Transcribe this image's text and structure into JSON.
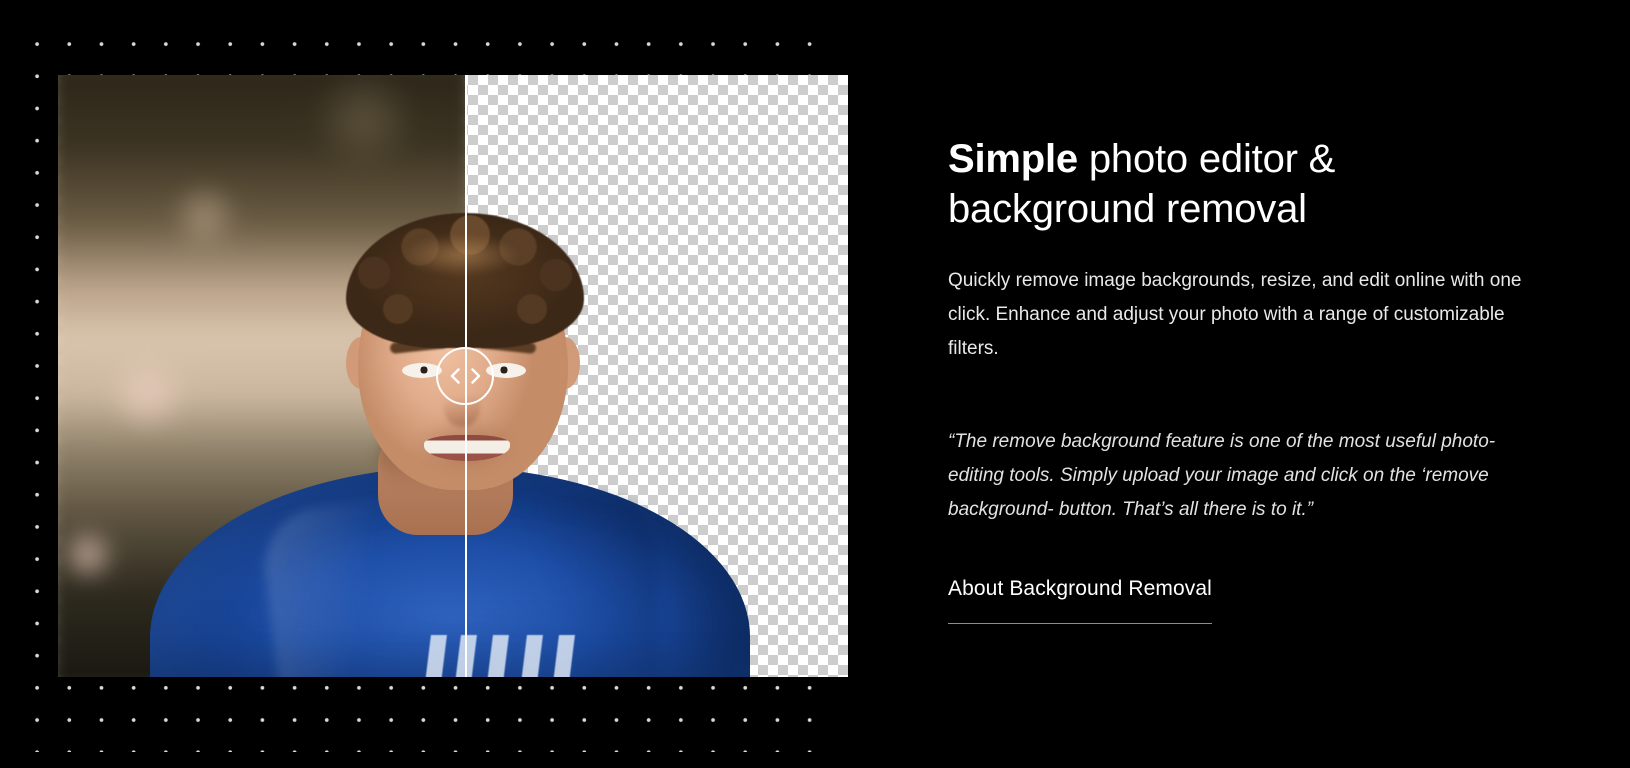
{
  "page": {
    "background_color": "#000000",
    "text_color": "#ffffff"
  },
  "decoration": {
    "dot_grid": {
      "dot_color": "#d9d9d9",
      "spacing_px": 32
    }
  },
  "media": {
    "widget_name": "before-after-comparison-slider",
    "before_label": "original photo with background",
    "after_label": "photo with background removed (transparent checkerboard)",
    "divider_position_percent": 51,
    "handle_icon_left": "chevron-left-icon",
    "handle_icon_right": "chevron-right-icon",
    "subject": "smiling young man with curly hair in a blue t-shirt",
    "shirt_color": "#1e4fa8",
    "checker_light": "#ffffff",
    "checker_dark": "#cdcdcd"
  },
  "content": {
    "headline_strong": "Simple",
    "headline_rest": " photo editor & background removal",
    "lede": "Quickly remove image backgrounds, resize, and edit online with one click. Enhance and adjust your photo with a range of customizable filters.",
    "quote": "“The remove background feature is one of the most useful photo-editing tools. Simply upload your image and click on the ‘remove background- button. That’s all there is to it.”",
    "link_label": "About Background Removal"
  }
}
